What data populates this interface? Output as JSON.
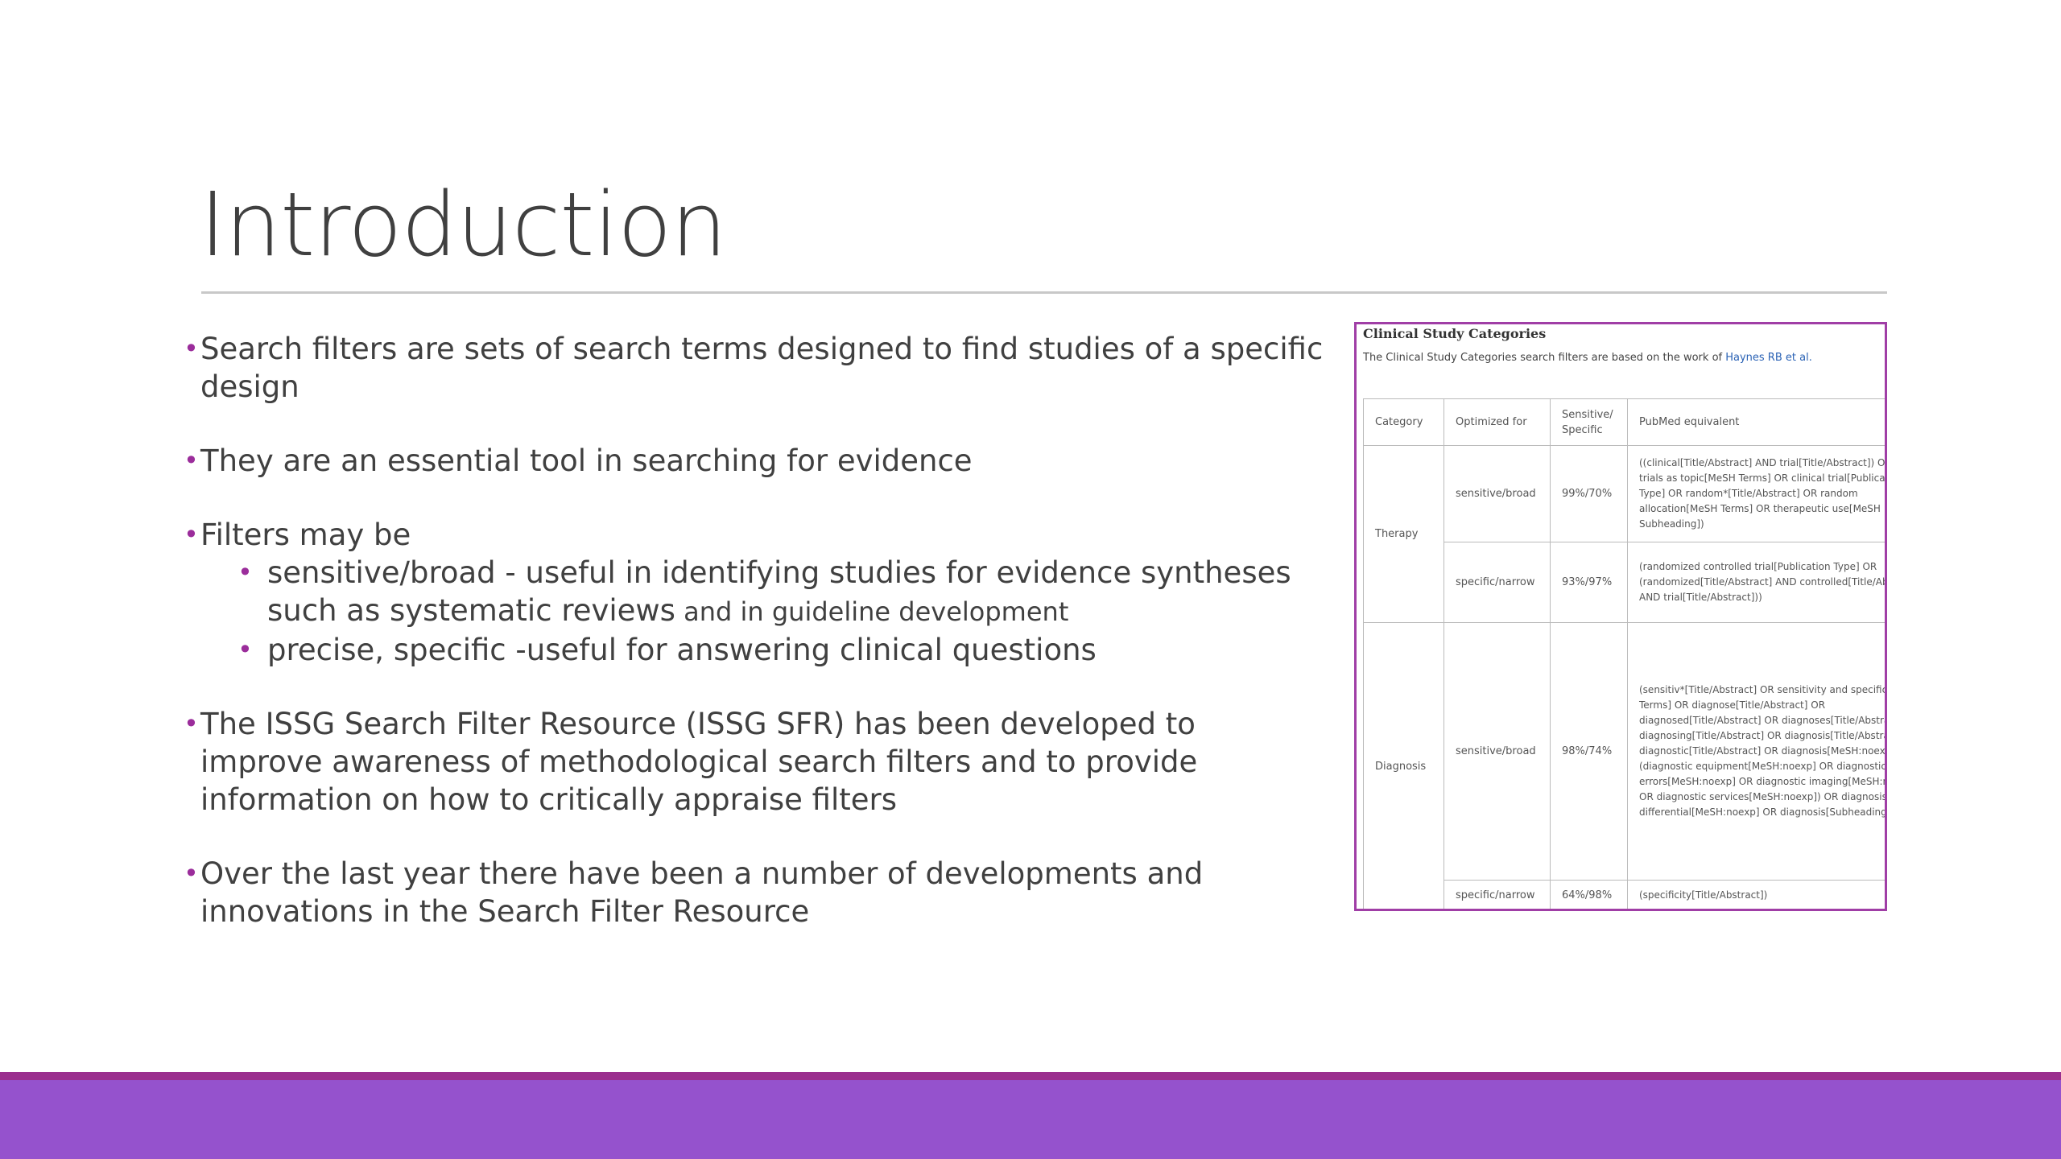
{
  "slide": {
    "title": "Introduction",
    "bullets": [
      "Search filters are sets of search terms designed to find studies of a specific design",
      "They are an essential tool in searching for evidence",
      "Filters may be",
      "The ISSG Search Filter Resource (ISSG SFR) has been developed to improve awareness of methodological search filters and to provide information on how to critically appraise filters",
      "Over the last year there have been a number of developments and innovations in the Search Filter Resource"
    ],
    "sub_bullets": {
      "broad_main": "sensitive/broad - useful in identifying studies for evidence syntheses such as systematic reviews",
      "broad_tail": " and in guideline development",
      "specific": "precise, specific  -useful for answering clinical questions"
    }
  },
  "screenshot": {
    "heading": "Clinical Study Categories",
    "description": "The Clinical Study Categories search filters are based on the work of ",
    "description_link": "Haynes RB et al.",
    "columns": [
      "Category",
      "Optimized for",
      "Sensitive/ Specific",
      "PubMed equivalent"
    ],
    "rows": [
      {
        "category": "Therapy",
        "optimized": "sensitive/broad",
        "value": "99%/70%",
        "pubmed": "((clinical[Title/Abstract] AND trial[Title/Abstract]) OR clinical trials as topic[MeSH Terms] OR clinical trial[Publication Type] OR random*[Title/Abstract] OR random allocation[MeSH Terms] OR therapeutic use[MeSH Subheading])"
      },
      {
        "optimized": "specific/narrow",
        "value": "93%/97%",
        "pubmed": "(randomized controlled trial[Publication Type] OR (randomized[Title/Abstract] AND controlled[Title/Abstract] AND trial[Title/Abstract]))"
      },
      {
        "category": "Diagnosis",
        "optimized": "sensitive/broad",
        "value": "98%/74%",
        "pubmed": "(sensitiv*[Title/Abstract] OR sensitivity and specificity[MeSH Terms] OR diagnose[Title/Abstract] OR diagnosed[Title/Abstract] OR diagnoses[Title/Abstract] OR diagnosing[Title/Abstract] OR diagnosis[Title/Abstract] OR diagnostic[Title/Abstract] OR diagnosis[MeSH:noexp] OR (diagnostic equipment[MeSH:noexp] OR diagnostic errors[MeSH:noexp] OR diagnostic imaging[MeSH:noexp] OR diagnostic services[MeSH:noexp]) OR diagnosis, differential[MeSH:noexp] OR diagnosis[Subheading:noexp])"
      },
      {
        "optimized": "specific/narrow",
        "value": "64%/98%",
        "pubmed": "(specificity[Title/Abstract])"
      }
    ]
  },
  "theme": {
    "accent": "#9b2d9b",
    "bar": "#9552cd",
    "bar_border": "#9a2e8e"
  }
}
